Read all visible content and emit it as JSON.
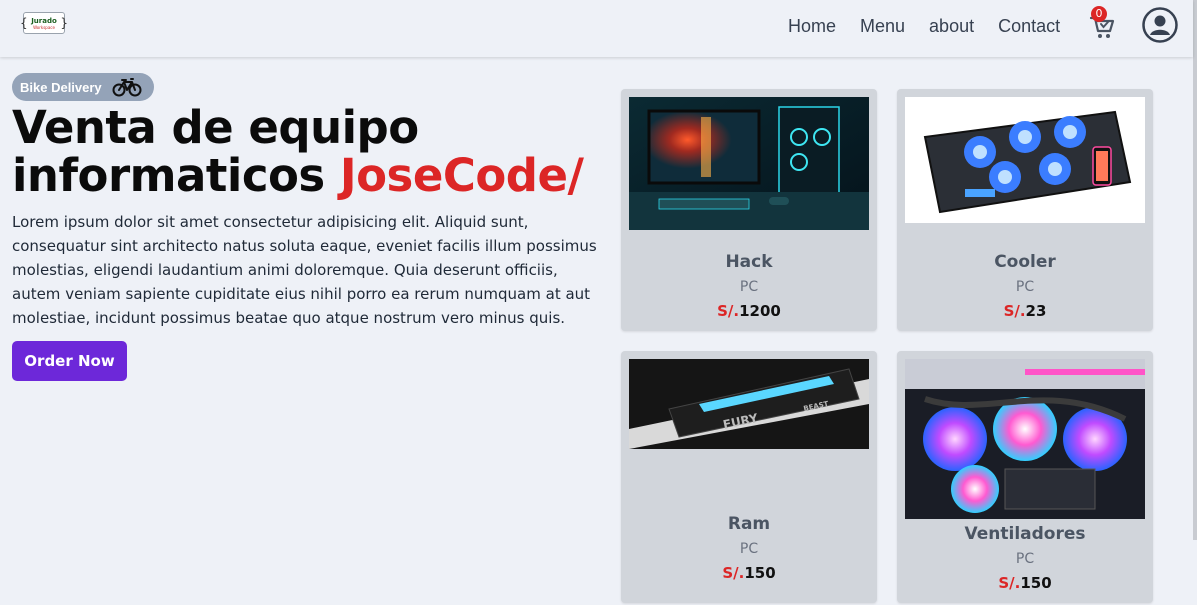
{
  "header": {
    "logo": {
      "brand": "Jurado",
      "sub": "Workspace"
    },
    "nav": [
      {
        "label": "Home"
      },
      {
        "label": "Menu"
      },
      {
        "label": "about"
      },
      {
        "label": "Contact"
      }
    ],
    "cart_count": "0"
  },
  "hero": {
    "badge": "Bike Delivery",
    "title_line1": "Venta de equipo",
    "title_line2": "informaticos",
    "title_accent": "JoseCode/",
    "description": "Lorem ipsum dolor sit amet consectetur adipisicing elit. Aliquid sunt, consequatur sint architecto natus soluta eaque, eveniet facilis illum possimus molestias, eligendi laudantium animi doloremque. Quia deserunt officiis, autem veniam sapiente cupiditate eius nihil porro ea rerum numquam at aut molestiae, incidunt possimus beatae quo atque nostrum vero minus quis.",
    "cta": "Order Now"
  },
  "products": [
    {
      "name": "Hack",
      "category": "PC",
      "currency": "S/.",
      "price": "1200",
      "image": "gaming-pc-setup"
    },
    {
      "name": "Cooler",
      "category": "PC",
      "currency": "S/.",
      "price": "23",
      "image": "laptop-cooler"
    },
    {
      "name": "Ram",
      "category": "PC",
      "currency": "S/.",
      "price": "150",
      "image": "ram-module"
    },
    {
      "name": "Ventiladores",
      "category": "PC",
      "currency": "S/.",
      "price": "150",
      "image": "rgb-fans"
    }
  ],
  "colors": {
    "accent": "#dc2626",
    "button": "#6d28d9",
    "card": "#d1d5db",
    "background": "#eef1f7"
  }
}
